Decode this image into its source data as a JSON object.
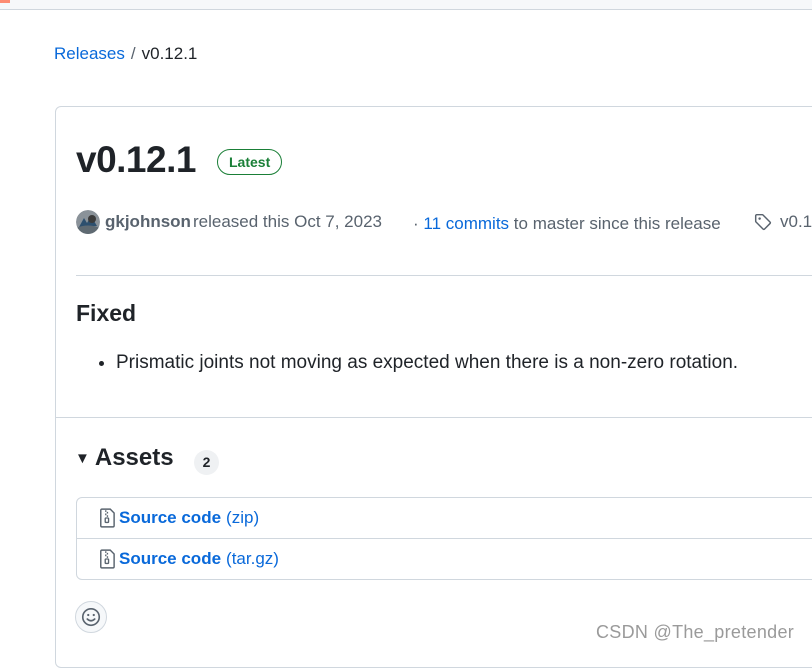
{
  "breadcrumb": {
    "parent": "Releases",
    "separator": "/",
    "current": "v0.12.1"
  },
  "release": {
    "title": "v0.12.1",
    "badge": "Latest",
    "author": "gkjohnson",
    "released_text": "released this Oct 7, 2023",
    "commits_prefix": "·",
    "commits_link": "11 commits",
    "commits_suffix": "to master since this release",
    "tag": "v0.1"
  },
  "notes": {
    "heading": "Fixed",
    "items": [
      "Prismatic joints not moving as expected when there is a non-zero rotation."
    ]
  },
  "assets": {
    "title": "Assets",
    "count": "2",
    "items": [
      {
        "name": "Source code",
        "ext": "(zip)"
      },
      {
        "name": "Source code",
        "ext": "(tar.gz)"
      }
    ]
  },
  "icons": {
    "tag": "tag-icon",
    "zip": "file-zip-icon",
    "smiley": "smiley-icon",
    "caret": "triangle-down-icon"
  },
  "colors": {
    "link": "#0969da",
    "badge_green": "#1a7f37",
    "border": "#d0d7de",
    "muted": "#59636e"
  },
  "watermark": "CSDN @The_pretender"
}
